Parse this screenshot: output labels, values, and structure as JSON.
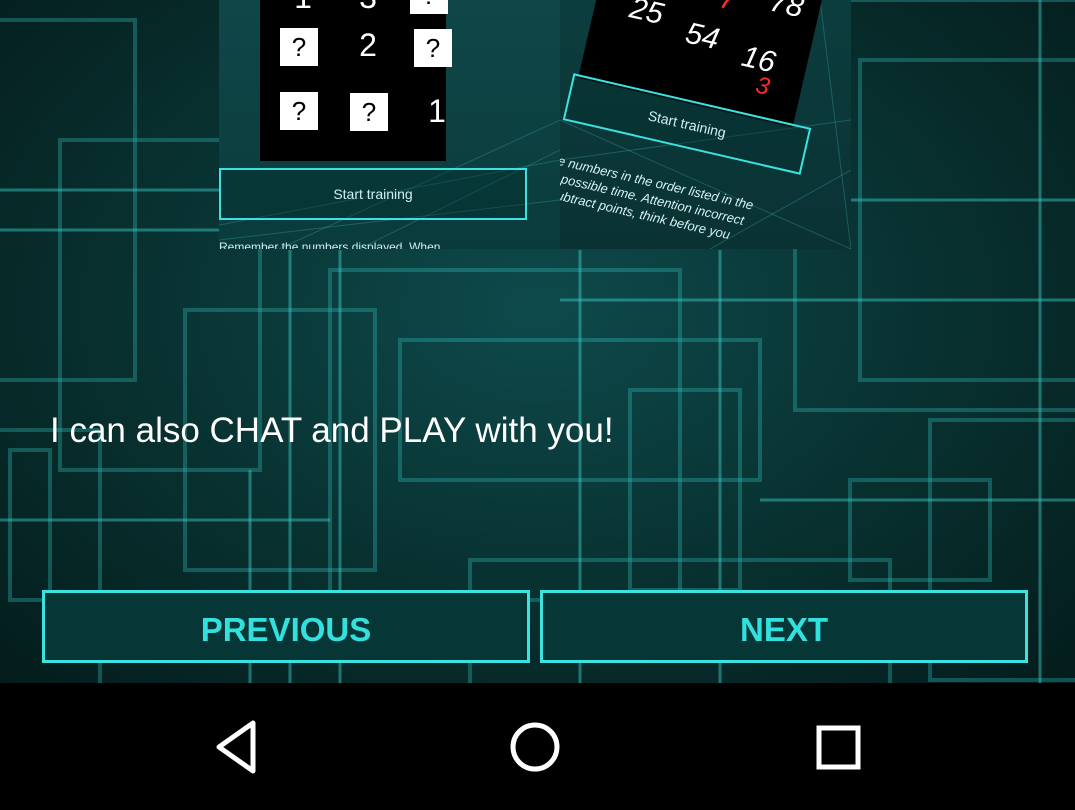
{
  "preview_left": {
    "grid": [
      "1",
      "3",
      "?",
      "?",
      "2",
      "?",
      "?",
      "?",
      "1"
    ],
    "start_label": "Start training",
    "footer_text": "Remember the numbers displayed. When"
  },
  "preview_right": {
    "numbers": [
      "7",
      "78",
      "25",
      "54",
      "16",
      "3"
    ],
    "start_label": "Start training",
    "desc_lines": [
      "e numbers in the order listed in the",
      "t possible time. Attention incorrect",
      "subtract points, think before you"
    ]
  },
  "message": "I can also CHAT and PLAY with you!",
  "buttons": {
    "previous": "PREVIOUS",
    "next": "NEXT"
  },
  "navbar": {
    "back_icon": "back-icon",
    "home_icon": "home-icon",
    "recents_icon": "recents-icon"
  },
  "colors": {
    "accent": "#32e0de",
    "background": "#08302f",
    "navbar": "#000000"
  }
}
